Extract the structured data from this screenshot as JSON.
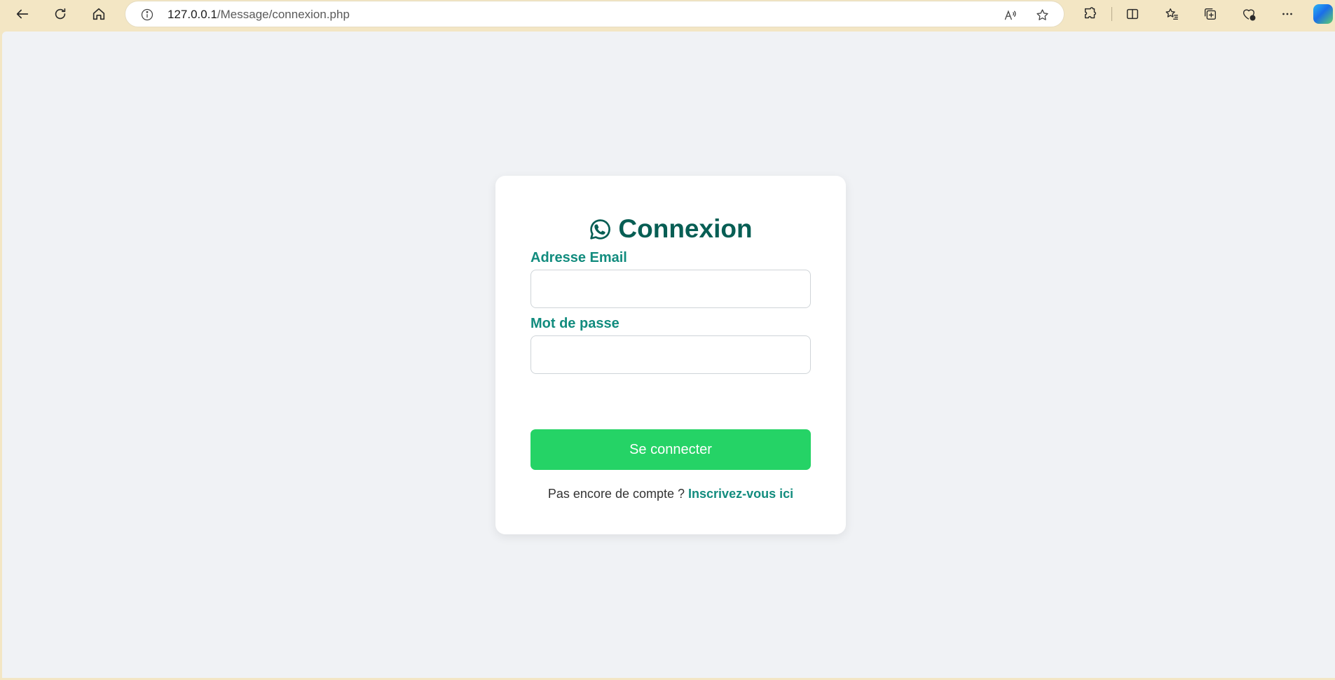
{
  "browser": {
    "url_host": "127.0.0.1",
    "url_path": "/Message/connexion.php",
    "icons": {
      "back": "back-arrow-icon",
      "refresh": "refresh-icon",
      "home": "home-icon",
      "site_info": "info-icon",
      "read_aloud": "read-aloud-icon",
      "favorite": "star-icon",
      "extensions": "extensions-icon",
      "split_screen": "split-screen-icon",
      "favorites": "favorites-icon",
      "collections": "collections-icon",
      "health": "browser-essentials-icon",
      "more": "more-icon",
      "copilot": "copilot-icon"
    }
  },
  "login": {
    "title": "Connexion",
    "title_icon": "whatsapp-icon",
    "email_label": "Adresse Email",
    "email_value": "",
    "password_label": "Mot de passe",
    "password_value": "",
    "submit_label": "Se connecter",
    "signup_prompt": "Pas encore de compte ?",
    "signup_link": "Inscrivez-vous ici"
  },
  "colors": {
    "title": "#075e54",
    "label": "#128c7e",
    "button": "#25d366",
    "page_background": "#f0f2f5",
    "browser_frame": "#f3e6c4"
  }
}
